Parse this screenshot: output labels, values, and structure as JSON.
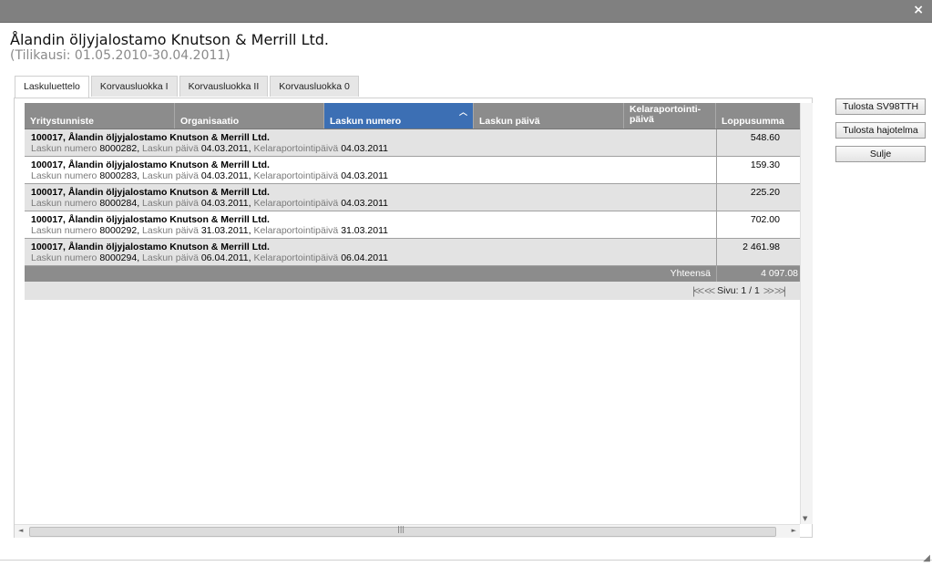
{
  "window": {
    "close_label": "×"
  },
  "header": {
    "title": "Ålandin öljyjalostamo Knutson & Merrill Ltd.",
    "period": "(Tilikausi: 01.05.2010-30.04.2011)"
  },
  "tabs": [
    {
      "label": "Laskuluettelo",
      "active": true
    },
    {
      "label": "Korvausluokka I",
      "active": false
    },
    {
      "label": "Korvausluokka II",
      "active": false
    },
    {
      "label": "Korvausluokka 0",
      "active": false
    }
  ],
  "table": {
    "columns": [
      {
        "label": "Yritystunniste"
      },
      {
        "label": "Organisaatio"
      },
      {
        "label": "Laskun numero",
        "sorted": "asc"
      },
      {
        "label": "Laskun päivä"
      },
      {
        "label": "Kelaraportointi-",
        "label2": "päivä"
      },
      {
        "label": "Loppusumma"
      }
    ],
    "field_labels": {
      "invoice_number": "Laskun numero",
      "invoice_date": "Laskun päivä",
      "report_date": "Kelaraportointipäivä"
    },
    "rows": [
      {
        "title": "100017, Ålandin öljyjalostamo Knutson & Merrill Ltd.",
        "invoice_number": "8000282,",
        "invoice_date": "04.03.2011,",
        "report_date": "04.03.2011",
        "amount": "548.60"
      },
      {
        "title": "100017, Ålandin öljyjalostamo Knutson & Merrill Ltd.",
        "invoice_number": "8000283,",
        "invoice_date": "04.03.2011,",
        "report_date": "04.03.2011",
        "amount": "159.30"
      },
      {
        "title": "100017, Ålandin öljyjalostamo Knutson & Merrill Ltd.",
        "invoice_number": "8000284,",
        "invoice_date": "04.03.2011,",
        "report_date": "04.03.2011",
        "amount": "225.20"
      },
      {
        "title": "100017, Ålandin öljyjalostamo Knutson & Merrill Ltd.",
        "invoice_number": "8000292,",
        "invoice_date": "31.03.2011,",
        "report_date": "31.03.2011",
        "amount": "702.00"
      },
      {
        "title": "100017, Ålandin öljyjalostamo Knutson & Merrill Ltd.",
        "invoice_number": "8000294,",
        "invoice_date": "06.04.2011,",
        "report_date": "06.04.2011",
        "amount": "2 461.98"
      }
    ],
    "total_label": "Yhteensä",
    "total_value": "4 097.08",
    "pager": {
      "text": "Sivu: 1 / 1"
    }
  },
  "side_buttons": {
    "print_sv98": "Tulosta SV98TTH",
    "print_breakdown": "Tulosta hajotelma",
    "close": "Sulje"
  },
  "colors": {
    "header_bg": "#8c8c8c",
    "sorted_header_bg": "#3c6fb4",
    "alt_row_bg": "#e3e3e3"
  }
}
